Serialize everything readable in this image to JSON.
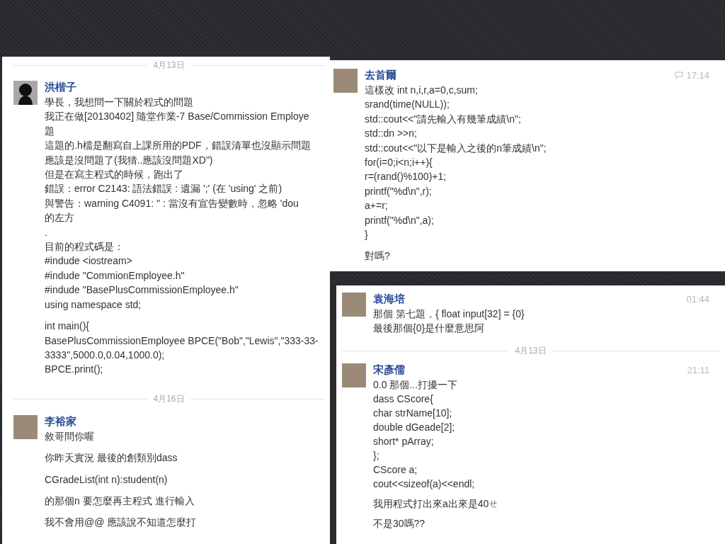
{
  "panels": [
    {
      "items": [
        {
          "kind": "date",
          "text": "4月13日"
        },
        {
          "kind": "message",
          "sender": "洪楷子",
          "avatar": {
            "kind": "silhouette"
          },
          "paragraphs": [
            [
              "學長，我想問一下關於程式的問題",
              "我正在做[20130402] 隨堂作業-7 Base/Commission Employe",
              "題",
              "這題的.h檔是翻寫自上課所用的PDF，錯誤清單也沒顯示問題",
              "應該是沒問題了(我猜..應該沒問題XD\")",
              "但是在寫主程式的時候，跑出了",
              "錯誤：error C2143: 語法錯誤 : 遺漏 ';' (在 'using' 之前)",
              "與警告：warning C4091: '' : 當沒有宣告變數時，忽略 'dou",
              "的左方",
              ".",
              "目前的程式碼是：",
              "#indude <iostream>",
              "#indude \"CommionEmployee.h\"",
              "#indude \"BasePlusCommissionEmployee.h\"",
              "using namespace std;"
            ],
            [
              "int main(){",
              "BasePlusCommissionEmployee BPCE(\"Bob\",\"Lewis\",\"333-33-",
              "3333\",5000.0,0.04,1000.0);",
              "BPCE.print();"
            ]
          ]
        },
        {
          "kind": "date",
          "text": "4月16日"
        },
        {
          "kind": "message",
          "sender": "李裕家",
          "avatar": {
            "kind": "photo"
          },
          "paragraphs": [
            [
              "敘哥問你喔"
            ],
            [
              "你昨天實況 最後的創類別dass"
            ],
            [
              "CGradeList(int n):student(n)"
            ],
            [
              "的那個n 要怎麼再主程式 進行輸入"
            ],
            [
              "我不會用@@ 應該說不知道怎麼打"
            ]
          ]
        }
      ]
    },
    {
      "items": [
        {
          "kind": "message",
          "sender": "去首爾",
          "avatar": {
            "kind": "photo"
          },
          "time": "17:14",
          "comment_icon": true,
          "paragraphs": [
            [
              "這樣改 int n,i,r,a=0,c,sum;",
              "srand(time(NULL));",
              "std::cout<<\"請先輸入有幾筆成績\\n\";",
              "std::dn >>n;",
              "std::cout<<\"以下是輸入之後的n筆成績\\n\";",
              "for(i=0;i<n;i++){",
              "r=(rand()%100)+1;",
              "printf(\"%d\\n\",r);",
              "a+=r;",
              "printf(\"%d\\n\",a);",
              "}"
            ],
            [
              "對嗎?"
            ]
          ]
        }
      ]
    },
    {
      "items": [
        {
          "kind": "message",
          "sender": "袁海培",
          "avatar": {
            "kind": "photo"
          },
          "time": "01:44",
          "comment_icon": false,
          "paragraphs": [
            [
              "那個 第七題，{ float input[32] = {0}",
              "最後那個{0}是什麼意思阿"
            ]
          ]
        },
        {
          "kind": "date",
          "text": "4月13日"
        },
        {
          "kind": "message",
          "sender": "宋彥儒",
          "avatar": {
            "kind": "photo"
          },
          "time": "21:11",
          "comment_icon": false,
          "paragraphs": [
            [
              "0.0 那個...打擾一下",
              "dass CScore{",
              "char strName[10];",
              "double dGeade[2];",
              "short* pArray;",
              "};",
              "CScore a;",
              "cout<<sizeof(a)<<endl;"
            ],
            [
              "我用程式打出來a出來是40ㄝ"
            ],
            [
              "不是30嗎??"
            ]
          ]
        }
      ]
    }
  ]
}
